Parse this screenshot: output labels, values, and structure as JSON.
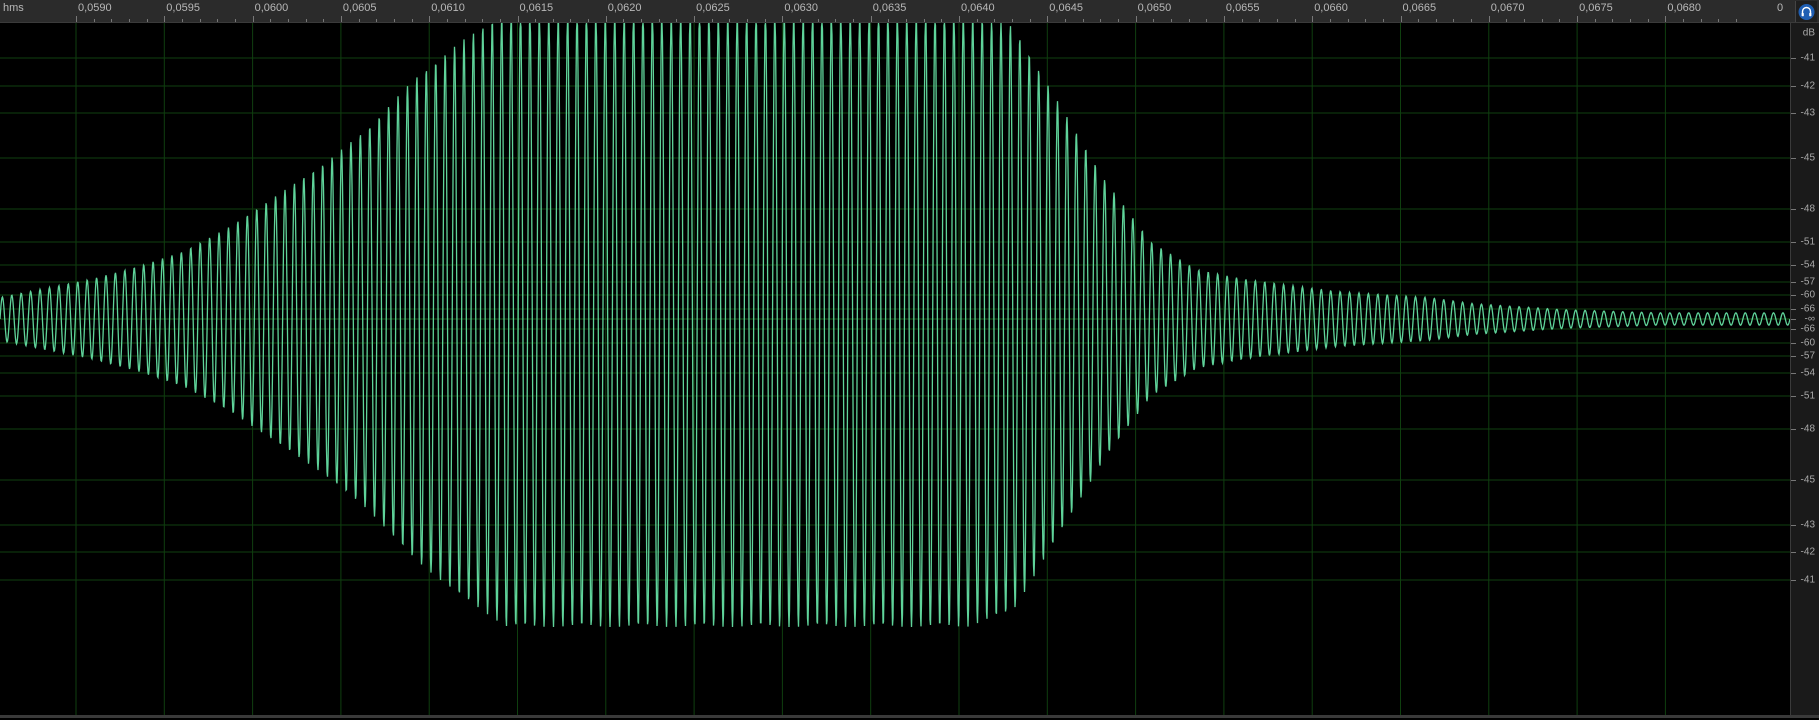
{
  "ruler": {
    "units_label": "hms",
    "ticks": [
      "0,0590",
      "0,0595",
      "0,0600",
      "0,0605",
      "0,0610",
      "0,0615",
      "0,0620",
      "0,0625",
      "0,0630",
      "0,0635",
      "0,0640",
      "0,0645",
      "0,0650",
      "0,0655",
      "0,0660",
      "0,0665",
      "0,0670",
      "0,0675",
      "0,0680"
    ],
    "view_end_label": "0"
  },
  "amplitude_ruler": {
    "unit_label": "dB",
    "top_labels": [
      "-41",
      "-42",
      "-43",
      "-45",
      "-48",
      "-51",
      "-54",
      "-57",
      "-60",
      "-66"
    ],
    "center_label": "-∞",
    "bottom_labels": [
      "-66",
      "-60",
      "-57",
      "-54",
      "-51",
      "-48",
      "-45",
      "-43",
      "-42",
      "-41"
    ]
  },
  "corner": {
    "icon": "headphones-icon"
  },
  "colors": {
    "background": "#000000",
    "waveform": "#5fd39a",
    "grid": "#0f3f0f",
    "grid_center": "#1a5a1a"
  },
  "waveform": {
    "type": "line",
    "x_range": [
      0.05875,
      0.06847
    ],
    "y_range": [
      -1,
      1
    ],
    "envelope": [
      [
        0.05875,
        0.07
      ],
      [
        0.059,
        0.1
      ],
      [
        0.05925,
        0.13
      ],
      [
        0.0595,
        0.17
      ],
      [
        0.05975,
        0.22
      ],
      [
        0.06,
        0.3
      ],
      [
        0.06025,
        0.4
      ],
      [
        0.0605,
        0.5
      ],
      [
        0.06075,
        0.62
      ],
      [
        0.061,
        0.78
      ],
      [
        0.06125,
        0.9
      ],
      [
        0.0615,
        1.0
      ],
      [
        0.06175,
        1.0
      ],
      [
        0.062,
        1.0
      ],
      [
        0.06225,
        1.0
      ],
      [
        0.0625,
        1.0
      ],
      [
        0.06275,
        1.0
      ],
      [
        0.063,
        1.0
      ],
      [
        0.06325,
        1.0
      ],
      [
        0.0635,
        1.0
      ],
      [
        0.06375,
        1.0
      ],
      [
        0.064,
        1.0
      ],
      [
        0.06425,
        0.95
      ],
      [
        0.0645,
        0.7
      ],
      [
        0.06475,
        0.45
      ],
      [
        0.065,
        0.25
      ],
      [
        0.06525,
        0.16
      ],
      [
        0.0655,
        0.13
      ],
      [
        0.06575,
        0.11
      ],
      [
        0.066,
        0.09
      ],
      [
        0.06625,
        0.08
      ],
      [
        0.0665,
        0.07
      ],
      [
        0.06675,
        0.05
      ],
      [
        0.067,
        0.04
      ],
      [
        0.06725,
        0.03
      ],
      [
        0.0675,
        0.025
      ],
      [
        0.06775,
        0.02
      ],
      [
        0.068,
        0.02
      ],
      [
        0.06847,
        0.02
      ]
    ]
  }
}
